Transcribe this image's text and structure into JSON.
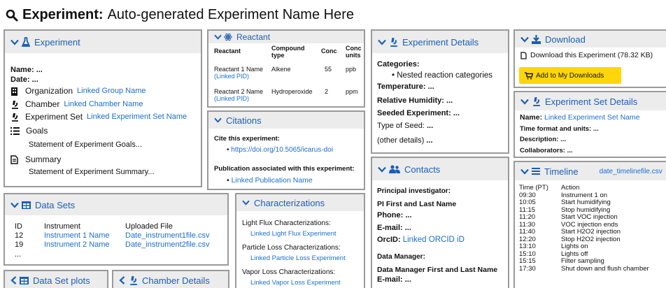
{
  "page": {
    "title_bold": "Experiment:",
    "title_rest": "Auto-generated Experiment Name Here"
  },
  "experiment": {
    "header": "Experiment",
    "name_label": "Name:",
    "name_value": "...",
    "date_label": "Date:",
    "date_value": "...",
    "organization_label": "Organization",
    "organization_link": "Linked Group Name",
    "chamber_label": "Chamber",
    "chamber_link": "Linked Chamber Name",
    "set_label": "Experiment Set",
    "set_link": "Linked Experiment Set Name",
    "goals_label": "Goals",
    "goals_text": "Statement of Experiment Goals...",
    "summary_label": "Summary",
    "summary_text": "Statement of Experiment Summary..."
  },
  "reactant": {
    "header": "Reactant",
    "columns": [
      "Reactant",
      "Compound type",
      "Conc",
      "Conc units"
    ],
    "rows": [
      {
        "name": "Reactant 1 Name",
        "pid": "(Linked PID)",
        "type": "Alkene",
        "conc": "55",
        "units": "ppb"
      },
      {
        "name": "Reactant 2 Name",
        "pid": "(Linked PID)",
        "type": "Hydroperoxide",
        "conc": "2",
        "units": "ppm"
      }
    ]
  },
  "citations": {
    "header": "Citations",
    "cite_label": "Cite this experiment:",
    "cite_link": "https://doi.org/10.5065/icarus-doi",
    "pub_label": "Publication associated with this experiment:",
    "pub_link": "Linked Publication Name"
  },
  "details": {
    "header": "Experiment Details",
    "categories_label": "Categories:",
    "categories_item": "Nested reaction categories",
    "temperature_label": "Temperature:",
    "humidity_label": "Relative Humidity:",
    "seeded_label": "Seeded Experiment:",
    "seed_label": "Type of Seed:",
    "other_label": "(other details)",
    "ellipsis": "..."
  },
  "download": {
    "header": "Download",
    "text": "Download this Experiment (78.32 KB)",
    "button": "Add to My Downloads"
  },
  "set_details": {
    "header": "Experiment Set Details",
    "name_label": "Name:",
    "name_link": "Linked Experiment Set Name",
    "time_label": "Time format and units:",
    "desc_label": "Description:",
    "collab_label": "Collaborators:",
    "ellipsis": "..."
  },
  "contacts": {
    "header": "Contacts",
    "pi_label": "Principal investigator:",
    "pi_name": "PI First and Last Name",
    "phone_label": "Phone:",
    "email_label": "E-mail:",
    "orcid_label": "OrcID:",
    "orcid_link": "Linked ORCID iD",
    "dm_label": "Data Manager:",
    "dm_name": "Data Manager First and Last Name",
    "ellipsis": "..."
  },
  "timeline": {
    "header": "Timeline",
    "file_link": "date_timelinefile.csv",
    "col_time": "Time (PT)",
    "col_action": "Action",
    "rows": [
      {
        "time": "09:30",
        "action": "Instrument 1 on"
      },
      {
        "time": "10:05",
        "action": "Start humidifying"
      },
      {
        "time": "11:15",
        "action": "Stop humidifying"
      },
      {
        "time": "11:20",
        "action": "Start VOC injection"
      },
      {
        "time": "11:30",
        "action": "VOC injection ends"
      },
      {
        "time": "11:40",
        "action": "Start H2O2 injection"
      },
      {
        "time": "12:20",
        "action": "Stop H2O2 injection"
      },
      {
        "time": "13:10",
        "action": "Lights on"
      },
      {
        "time": "15:10",
        "action": "Lights off"
      },
      {
        "time": "15:15",
        "action": "Filter sampling"
      },
      {
        "time": "17:30",
        "action": "Shut down and flush chamber"
      }
    ]
  },
  "datasets": {
    "header": "Data Sets",
    "col_id": "ID",
    "col_instrument": "Instrument",
    "col_file": "Uploaded File",
    "rows": [
      {
        "id": "12",
        "instrument": "Instrument 1 Name",
        "file": "Date_instrument1file.csv"
      },
      {
        "id": "19",
        "instrument": "Instrument 2 Name",
        "file": "Date_instrument2file.csv"
      }
    ],
    "more": "..."
  },
  "characterizations": {
    "header": "Characterizations",
    "light_label": "Light Flux Characterizations:",
    "light_link": "Linked Light Flux Experiment",
    "particle_label": "Particle Loss Characterizations:",
    "particle_link": "Linked Particle Loss Experiment",
    "vapor_label": "Vapor Loss Characterizations:",
    "vapor_link": "Linked Vapor Loss Experiment"
  },
  "plots": {
    "header": "Data Set plots"
  },
  "chamber_details": {
    "header": "Chamber Details"
  }
}
